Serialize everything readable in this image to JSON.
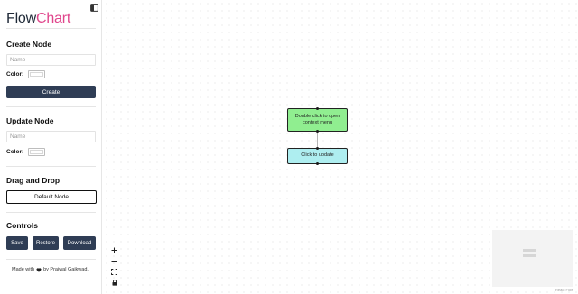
{
  "app": {
    "title_part1": "Flow",
    "title_part2": "Chart"
  },
  "sidebar": {
    "create": {
      "title": "Create Node",
      "name_placeholder": "Name",
      "color_label": "Color:",
      "color_value": "#ffffff",
      "button": "Create"
    },
    "update": {
      "title": "Update Node",
      "name_placeholder": "Name",
      "color_label": "Color:",
      "color_value": "#ffffff"
    },
    "drag": {
      "title": "Drag and Drop",
      "node_label": "Default Node"
    },
    "controls": {
      "title": "Controls",
      "save": "Save",
      "restore": "Restore",
      "download": "Download"
    },
    "footer": {
      "prefix": "Made with",
      "suffix": "by Prajwal Gaikwad."
    }
  },
  "canvas": {
    "nodes": [
      {
        "label": "Double click to open context menu",
        "color": "#90ee90"
      },
      {
        "label": "Click to update",
        "color": "#aeeef0"
      }
    ],
    "controls": {
      "zoom_in": "+",
      "zoom_out": "−"
    },
    "attribution": "React Flow"
  },
  "colors": {
    "accent": "#e0468c",
    "button_bg": "#2f3d55"
  }
}
